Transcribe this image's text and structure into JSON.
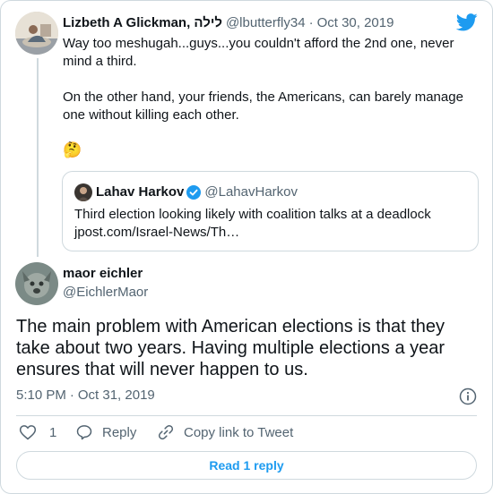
{
  "parent_tweet": {
    "author_name": "Lizbeth A Glickman, לילה",
    "handle": "@lbutterfly34",
    "separator": "·",
    "date": "Oct 30, 2019",
    "text": "Way too meshugah...guys...you couldn't afford the 2nd one, never mind a third.\n\nOn the other hand, your friends, the Americans, can barely manage one without killing each other.",
    "emoji": "🤔",
    "avatar_icon": "person-reading-avatar"
  },
  "quoted_tweet": {
    "author_name": "Lahav Harkov",
    "handle": "@LahavHarkov",
    "text": "Third election looking likely with coalition talks at a deadlock",
    "link": "jpost.com/Israel-News/Th…",
    "verified_icon": "verified-badge-icon"
  },
  "main_tweet": {
    "author_name": "maor eichler",
    "handle": "@EichlerMaor",
    "text": "The main problem with American elections is that they take about two years. Having multiple elections a year ensures that will never happen to us.",
    "time": "5:10 PM",
    "separator": "·",
    "date": "Oct 31, 2019"
  },
  "actions": {
    "like_count": "1",
    "reply_label": "Reply",
    "copy_label": "Copy link to Tweet"
  },
  "footer": {
    "read_replies_label": "Read 1 reply"
  },
  "colors": {
    "twitter_blue": "#1d9bf0",
    "text": "#0f1419",
    "muted": "#536471",
    "border": "#cfd9de"
  }
}
